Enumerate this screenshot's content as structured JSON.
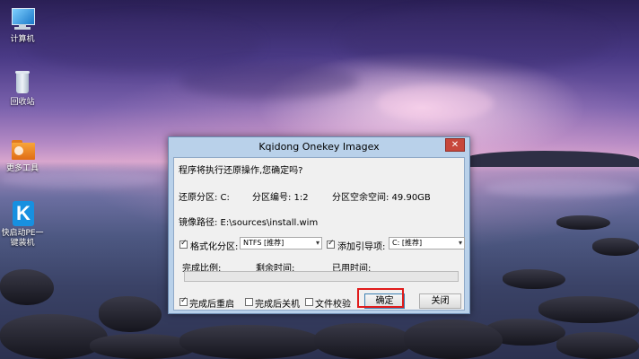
{
  "desktop": {
    "icons": [
      {
        "label": "计算机",
        "icon": "computer-icon"
      },
      {
        "label": "回收站",
        "icon": "recycle-bin-icon"
      },
      {
        "label": "更多工具",
        "icon": "folder-tools-icon"
      },
      {
        "label": "快启动PE一键装机",
        "icon": "kqidong-k-icon"
      }
    ]
  },
  "dialog": {
    "title": "Kqidong Onekey Imagex",
    "close_label": "✕",
    "prompt": "程序将执行还原操作,您确定吗?",
    "restore_partition_label": "还原分区: C:",
    "partition_number_label": "分区编号: 1:2",
    "free_space_label": "分区空余空间: 49.90GB",
    "image_path_label": "镜像路径: E:\\sources\\install.wim",
    "format_partition": {
      "label": "格式化分区:",
      "checked": true,
      "selected": "NTFS [推荐]"
    },
    "add_boot": {
      "label": "添加引导项:",
      "checked": true,
      "selected": "C: [推荐]"
    },
    "progress": {
      "ratio_label": "完成比例:",
      "remaining_label": "剩余时间:",
      "elapsed_label": "已用时间:",
      "percent": 0
    },
    "reboot_after": {
      "label": "完成后重启",
      "checked": true
    },
    "shutdown_after": {
      "label": "完成后关机",
      "checked": false
    },
    "verify_files": {
      "label": "文件校验",
      "checked": false
    },
    "ok_label": "确定",
    "close_button_label": "关闭",
    "highlight_color": "#e01b1b"
  }
}
